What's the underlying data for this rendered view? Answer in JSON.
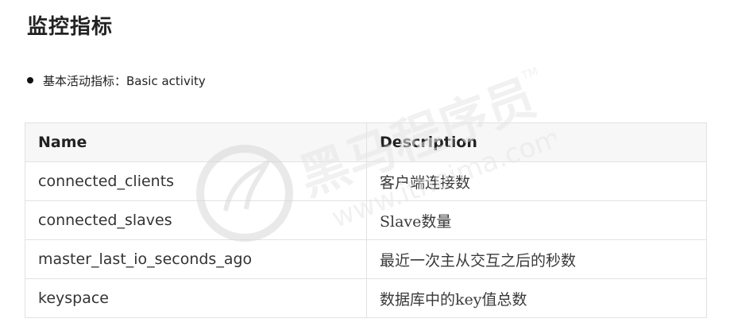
{
  "page": {
    "title": "监控指标"
  },
  "bullet": {
    "text": "基本活动指标：Basic activity"
  },
  "table": {
    "headers": {
      "name": "Name",
      "description": "Description"
    },
    "rows": [
      {
        "name": "connected_clients",
        "description": "客户端连接数"
      },
      {
        "name": "connected_slaves",
        "description": "Slave数量"
      },
      {
        "name": "master_last_io_seconds_ago",
        "description": "最近一次主从交互之后的秒数"
      },
      {
        "name": "keyspace",
        "description": "数据库中的key值总数"
      }
    ]
  },
  "watermark": {
    "brand": "黑马程序员",
    "trademark": "TM",
    "url": "www.itheima.com",
    "color": "#e6e6e6"
  }
}
